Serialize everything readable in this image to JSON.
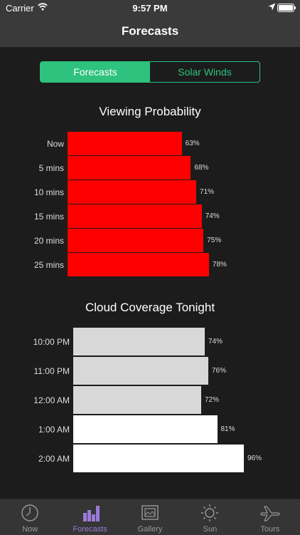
{
  "status_bar": {
    "carrier": "Carrier",
    "time": "9:57 PM"
  },
  "nav": {
    "title": "Forecasts"
  },
  "segment": {
    "items": [
      "Forecasts",
      "Solar Winds"
    ],
    "selected": "Forecasts"
  },
  "viewing": {
    "title": "Viewing Probability",
    "color": "#ff0000",
    "rows": [
      {
        "label": "Now",
        "value": 63,
        "text": "63%"
      },
      {
        "label": "5 mins",
        "value": 68,
        "text": "68%"
      },
      {
        "label": "10 mins",
        "value": 71,
        "text": "71%"
      },
      {
        "label": "15 mins",
        "value": 74,
        "text": "74%"
      },
      {
        "label": "20 mins",
        "value": 75,
        "text": "75%"
      },
      {
        "label": "25 mins",
        "value": 78,
        "text": "78%"
      }
    ]
  },
  "cloud": {
    "title": "Cloud Coverage Tonight",
    "rows": [
      {
        "label": "10:00 PM",
        "value": 74,
        "text": "74%",
        "color": "#d8d8d8"
      },
      {
        "label": "11:00 PM",
        "value": 76,
        "text": "76%",
        "color": "#d8d8d8"
      },
      {
        "label": "12:00 AM",
        "value": 72,
        "text": "72%",
        "color": "#d8d8d8"
      },
      {
        "label": "1:00 AM",
        "value": 81,
        "text": "81%",
        "color": "#ffffff"
      },
      {
        "label": "2:00 AM",
        "value": 96,
        "text": "96%",
        "color": "#ffffff"
      }
    ]
  },
  "tabs": [
    {
      "label": "Now",
      "icon": "clock-icon",
      "active": false
    },
    {
      "label": "Forecasts",
      "icon": "bar-chart-icon",
      "active": true
    },
    {
      "label": "Gallery",
      "icon": "gallery-icon",
      "active": false
    },
    {
      "label": "Sun",
      "icon": "sun-icon",
      "active": false
    },
    {
      "label": "Tours",
      "icon": "airplane-icon",
      "active": false
    }
  ],
  "colors": {
    "accent_green": "#2ec27e",
    "active_tab": "#9b7bd8",
    "background": "#1c1c1c"
  }
}
